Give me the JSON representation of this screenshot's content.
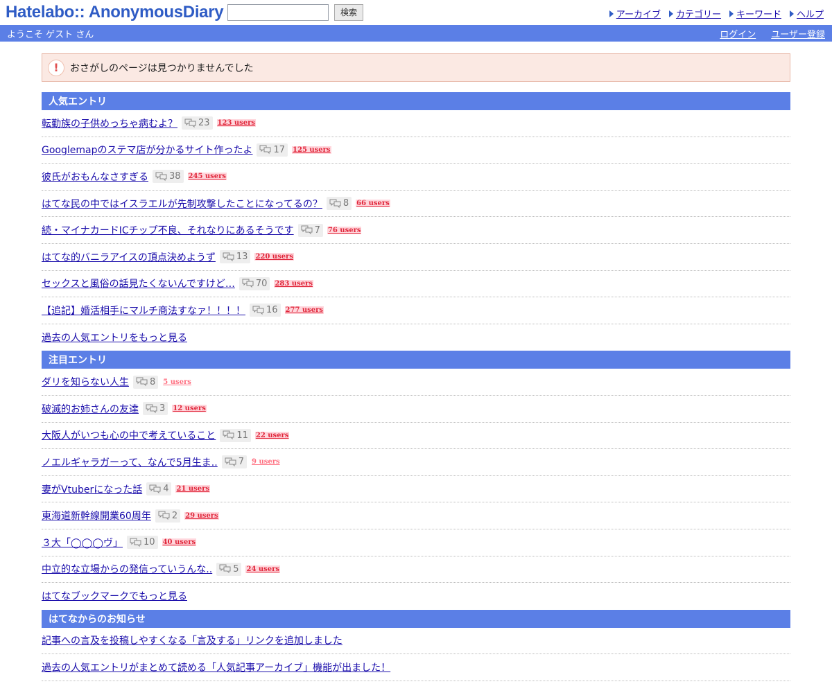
{
  "header": {
    "logo": "Hatelabo:: AnonymousDiary",
    "search_button": "検索",
    "nav": [
      "アーカイブ",
      "カテゴリー",
      "キーワード",
      "ヘルプ"
    ]
  },
  "welcome": {
    "text": "ようこそ ゲスト さん",
    "login": "ログイン",
    "register": "ユーザー登録"
  },
  "notice": {
    "icon": "!",
    "text": "おさがしのページは見つかりませんでした"
  },
  "popular": {
    "title": "人気エントリ",
    "entries": [
      {
        "title": "転勤族の子供めっちゃ病むよ？",
        "comments": "23",
        "users": "123 users"
      },
      {
        "title": "Googlemapのステマ店が分かるサイト作ったよ",
        "comments": "17",
        "users": "125 users"
      },
      {
        "title": "彼氏がおもんなさすぎる",
        "comments": "38",
        "users": "245 users"
      },
      {
        "title": "はてな民の中ではイスラエルが先制攻撃したことになってるの？",
        "comments": "8",
        "users": "66 users"
      },
      {
        "title": "続・マイナカードICチップ不良、それなりにあるそうです",
        "comments": "7",
        "users": "76 users"
      },
      {
        "title": "はてな的バニラアイスの頂点決めようず",
        "comments": "13",
        "users": "220 users"
      },
      {
        "title": "セックスと風俗の話見たくないんですけど…",
        "comments": "70",
        "users": "283 users"
      },
      {
        "title": "【追記】婚活相手にマルチ商法すなァ！！！！",
        "comments": "16",
        "users": "277 users"
      }
    ],
    "more": "過去の人気エントリをもっと見る"
  },
  "notable": {
    "title": "注目エントリ",
    "entries": [
      {
        "title": "ダリを知らない人生",
        "comments": "8",
        "users": "5 users",
        "light": true
      },
      {
        "title": "破滅的お姉さんの友達",
        "comments": "3",
        "users": "12 users"
      },
      {
        "title": "大阪人がいつも心の中で考えていること",
        "comments": "11",
        "users": "22 users"
      },
      {
        "title": "ノエルギャラガーって、なんで5月生ま..",
        "comments": "7",
        "users": "9 users",
        "light": true
      },
      {
        "title": "妻がVtuberになった話",
        "comments": "4",
        "users": "21 users"
      },
      {
        "title": "東海道新幹線開業60周年",
        "comments": "2",
        "users": "29 users"
      },
      {
        "title": "３大「◯◯◯ヴ」",
        "comments": "10",
        "users": "40 users"
      },
      {
        "title": "中立的な立場からの発信っていうんな..",
        "comments": "5",
        "users": "24 users"
      }
    ],
    "more": "はてなブックマークでもっと見る"
  },
  "news": {
    "title": "はてなからのお知らせ",
    "entries": [
      "記事への言及を投稿しやすくなる「言及する」リンクを追加しました",
      "過去の人気エントリがまとめて読める「人気記事アーカイブ」機能が出ました！"
    ]
  }
}
